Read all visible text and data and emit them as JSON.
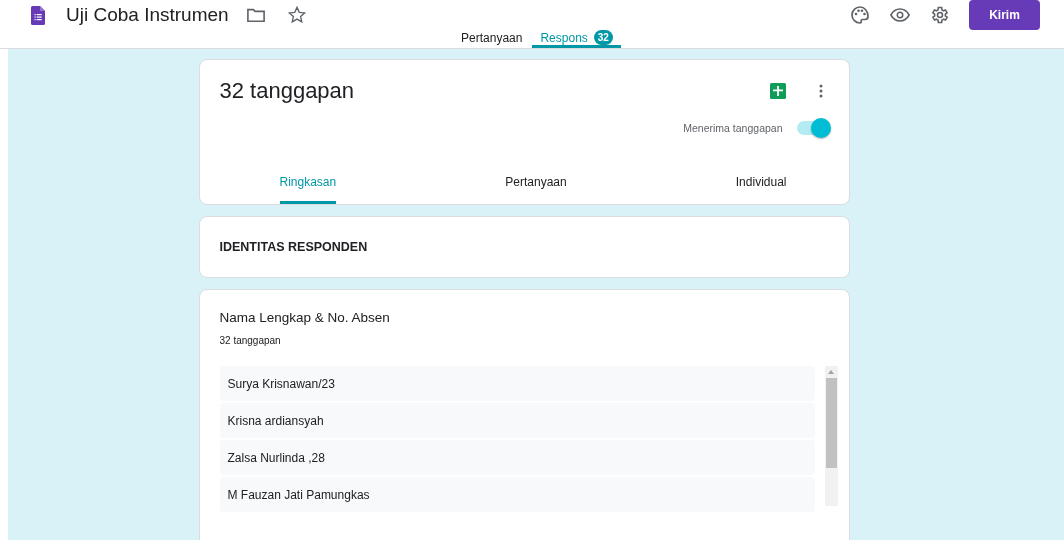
{
  "header": {
    "title": "Uji Coba Instrumen",
    "starred": false,
    "send_button": "Kirim"
  },
  "tabs": [
    {
      "label": "Pertanyaan",
      "selected": false
    },
    {
      "label": "Respons",
      "selected": true,
      "badge": "32"
    }
  ],
  "summary": {
    "title": "32 tanggapan",
    "accepting_label": "Menerima tanggapan",
    "accepting": true,
    "subtabs": [
      {
        "label": "Ringkasan",
        "selected": true
      },
      {
        "label": "Pertanyaan",
        "selected": false
      },
      {
        "label": "Individual",
        "selected": false
      }
    ]
  },
  "section": {
    "title": "IDENTITAS RESPONDEN"
  },
  "question": {
    "title": "Nama Lengkap & No. Absen",
    "count": "32 tanggapan",
    "responses": [
      "Surya Krisnawan/23",
      "Krisna ardiansyah",
      "Zalsa Nurlinda ,28",
      "M Fauzan Jati Pamungkas"
    ]
  }
}
